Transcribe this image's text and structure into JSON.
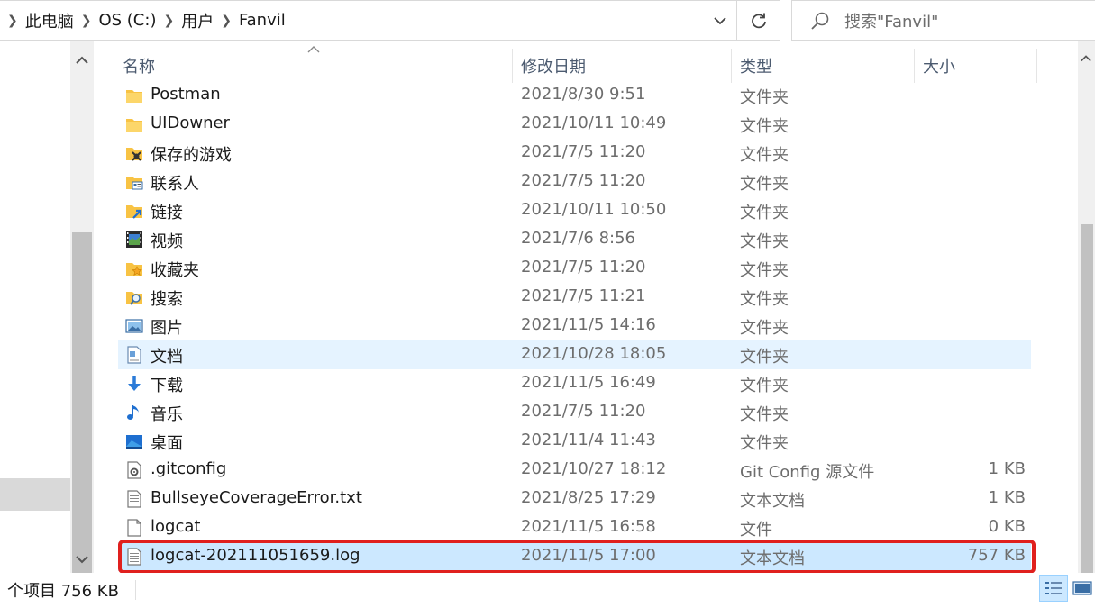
{
  "address": {
    "breadcrumbs": [
      "此电脑",
      "OS (C:)",
      "用户",
      "Fanvil"
    ]
  },
  "search": {
    "placeholder": "搜索\"Fanvil\""
  },
  "columns": {
    "name": "名称",
    "date": "修改日期",
    "type": "类型",
    "size": "大小"
  },
  "files": [
    {
      "name": "Postman",
      "date": "2021/8/30 9:51",
      "type": "文件夹",
      "size": "",
      "icon": "folder-icon"
    },
    {
      "name": "UIDowner",
      "date": "2021/10/11 10:49",
      "type": "文件夹",
      "size": "",
      "icon": "folder-icon"
    },
    {
      "name": "保存的游戏",
      "date": "2021/7/5 11:20",
      "type": "文件夹",
      "size": "",
      "icon": "saved-games-icon"
    },
    {
      "name": "联系人",
      "date": "2021/7/5 11:20",
      "type": "文件夹",
      "size": "",
      "icon": "contacts-icon"
    },
    {
      "name": "链接",
      "date": "2021/10/11 10:50",
      "type": "文件夹",
      "size": "",
      "icon": "links-icon"
    },
    {
      "name": "视频",
      "date": "2021/7/6 8:56",
      "type": "文件夹",
      "size": "",
      "icon": "videos-icon"
    },
    {
      "name": "收藏夹",
      "date": "2021/7/5 11:20",
      "type": "文件夹",
      "size": "",
      "icon": "favorites-icon"
    },
    {
      "name": "搜索",
      "date": "2021/7/5 11:21",
      "type": "文件夹",
      "size": "",
      "icon": "searches-icon"
    },
    {
      "name": "图片",
      "date": "2021/11/5 14:16",
      "type": "文件夹",
      "size": "",
      "icon": "pictures-icon"
    },
    {
      "name": "文档",
      "date": "2021/10/28 18:05",
      "type": "文件夹",
      "size": "",
      "icon": "documents-icon"
    },
    {
      "name": "下载",
      "date": "2021/11/5 16:49",
      "type": "文件夹",
      "size": "",
      "icon": "downloads-icon"
    },
    {
      "name": "音乐",
      "date": "2021/7/5 11:20",
      "type": "文件夹",
      "size": "",
      "icon": "music-icon"
    },
    {
      "name": "桌面",
      "date": "2021/11/4 11:43",
      "type": "文件夹",
      "size": "",
      "icon": "desktop-icon"
    },
    {
      "name": ".gitconfig",
      "date": "2021/10/27 18:12",
      "type": "Git Config 源文件",
      "size": "1 KB",
      "icon": "config-file-icon"
    },
    {
      "name": "BullseyeCoverageError.txt",
      "date": "2021/8/25 17:29",
      "type": "文本文档",
      "size": "1 KB",
      "icon": "text-file-icon"
    },
    {
      "name": "logcat",
      "date": "2021/11/5 16:58",
      "type": "文件",
      "size": "0 KB",
      "icon": "blank-file-icon"
    },
    {
      "name": "logcat-202111051659.log",
      "date": "2021/11/5 17:00",
      "type": "文本文档",
      "size": "757 KB",
      "icon": "text-file-icon"
    }
  ],
  "hover_row": 9,
  "selected_row": 16,
  "status": {
    "text": "个项目  756 KB"
  },
  "colors": {
    "selection": "#cce8ff",
    "hover": "#e5f3ff",
    "highlight_border": "#e0201e",
    "folder": "#f8c344"
  }
}
